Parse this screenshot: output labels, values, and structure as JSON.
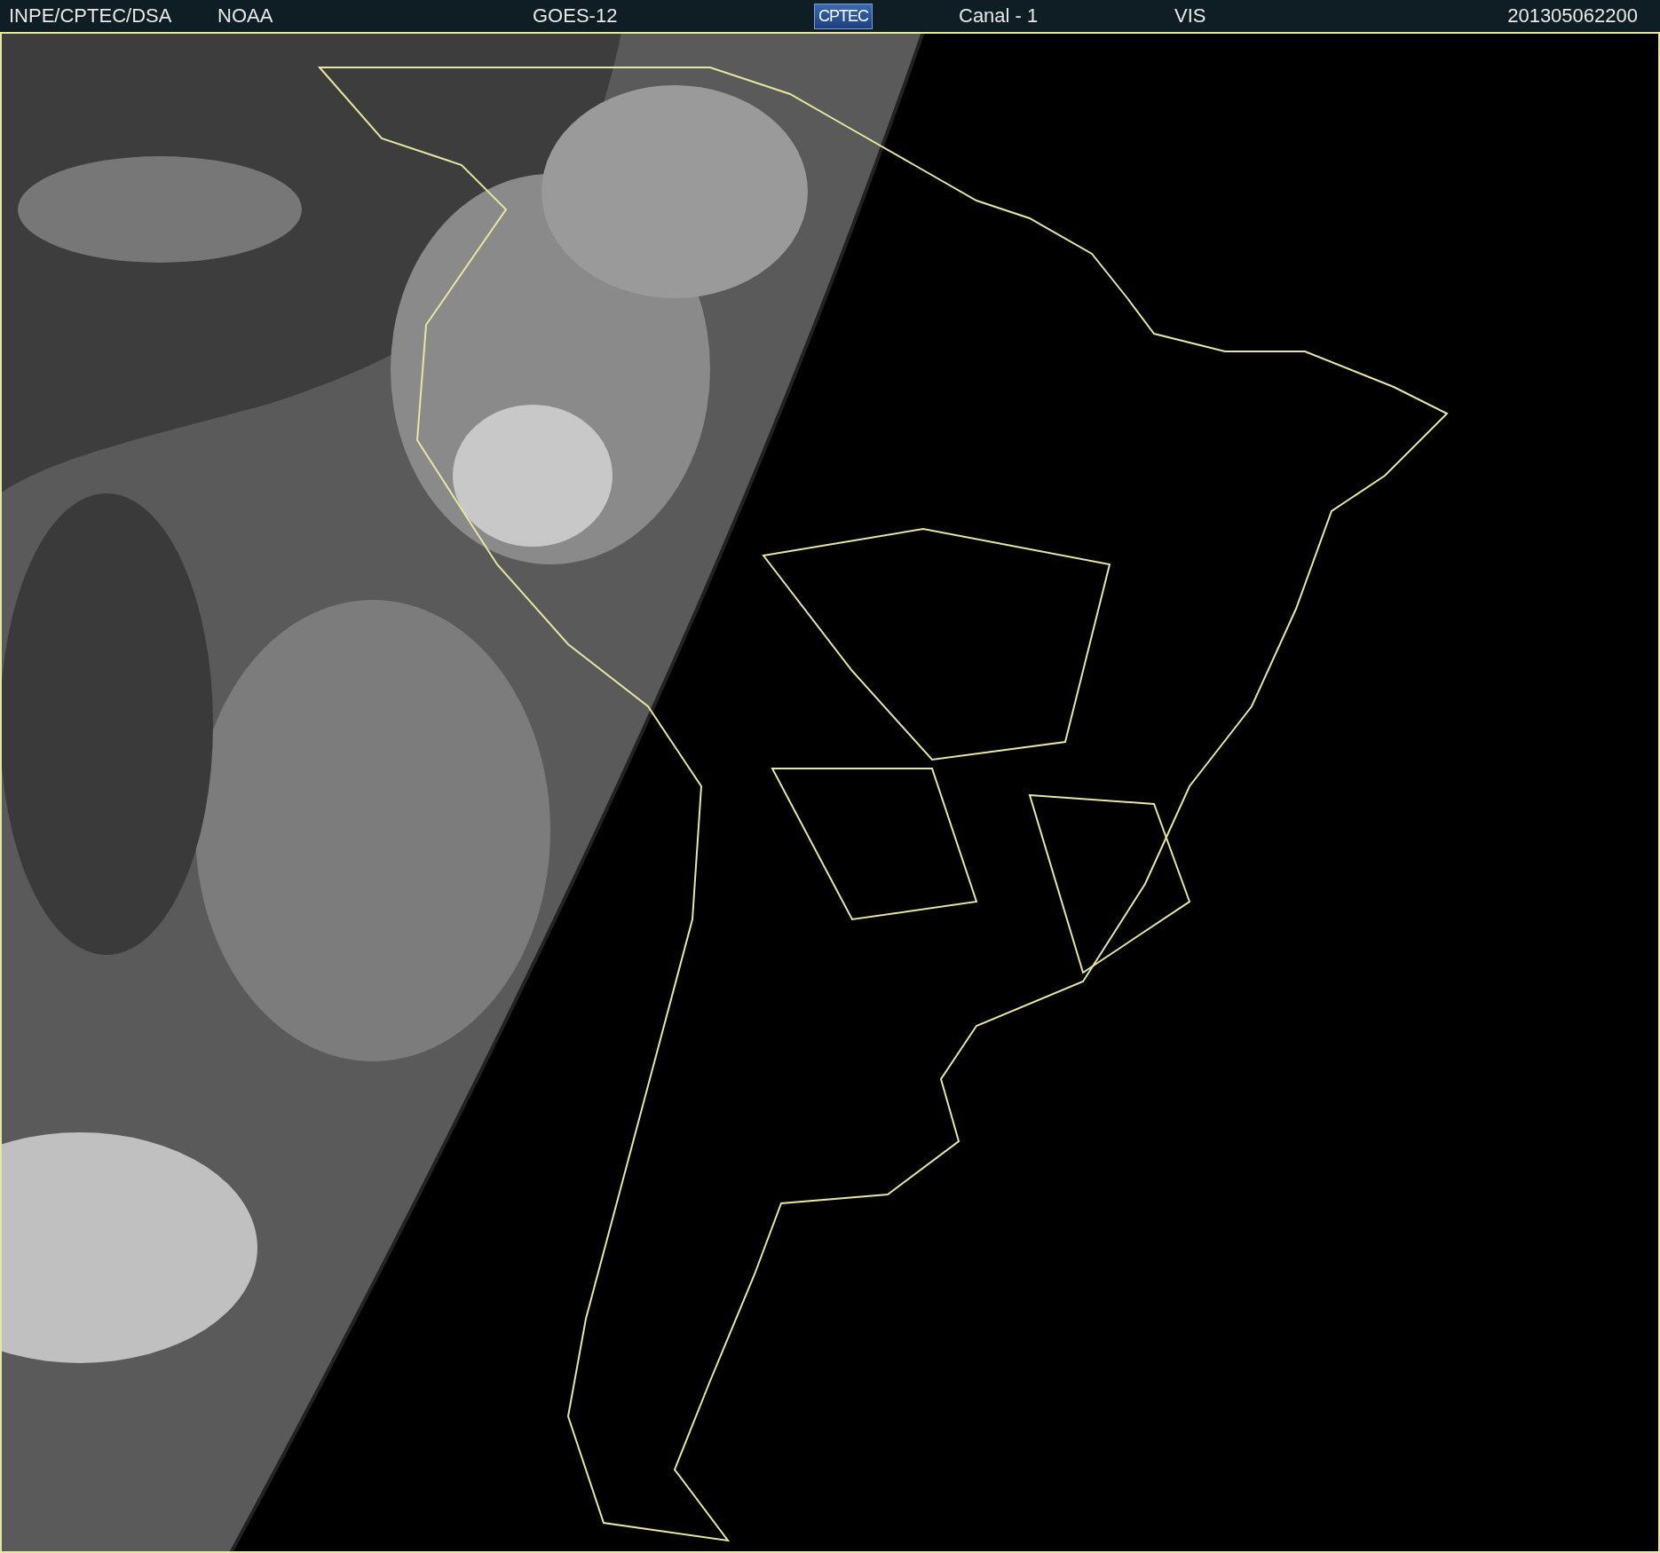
{
  "header": {
    "source": "INPE/CPTEC/DSA",
    "agency": "NOAA",
    "satellite": "GOES-12",
    "logo": "CPTEC",
    "channel": "Canal - 1",
    "band": "VIS",
    "timestamp": "201305062200"
  }
}
